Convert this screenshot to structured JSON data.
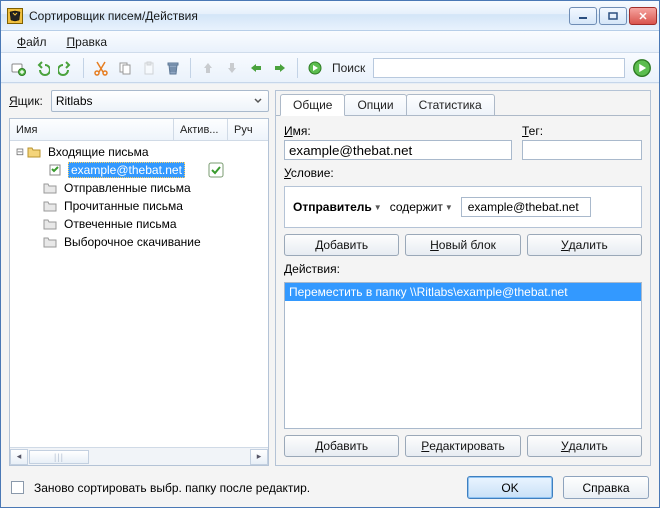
{
  "window": {
    "title": "Сортировщик писем/Действия"
  },
  "menu": {
    "file_u": "Ф",
    "file_rest": "айл",
    "edit_u": "П",
    "edit_rest": "равка"
  },
  "toolbar": {
    "search_label": "Поиск"
  },
  "left": {
    "box_u": "Я",
    "box_rest": "щик:",
    "combo_value": "Ritlabs",
    "col_name": "Имя",
    "col_active": "Актив...",
    "col_manual": "Руч",
    "nodes": {
      "inbox": "Входящие письма",
      "rule1": "example@thebat.net",
      "outbox": "Отправленные письма",
      "read": "Прочитанные письма",
      "replied": "Отвеченные письма",
      "selective": "Выборочное скачивание"
    },
    "thumb_marks": "|||"
  },
  "right": {
    "tab_general": "Общие",
    "tab_options": "Опции",
    "tab_stats": "Статистика",
    "name_u": "И",
    "name_rest": "мя:",
    "tag_u": "Т",
    "tag_rest": "ег:",
    "name_value": "example@thebat.net",
    "tag_value": "",
    "cond_u": "У",
    "cond_rest": "словие:",
    "cond_subject": "Отправитель",
    "cond_verb": "содержит",
    "cond_value": "example@thebat.net",
    "btn_add_u": "Д",
    "btn_add_rest": "обавить",
    "btn_newblock_u": "Н",
    "btn_newblock_rest": "овый блок",
    "btn_delete_u": "У",
    "btn_delete_rest": "далить",
    "actions_u": "Д",
    "actions_rest": "ействия:",
    "action_item": "Переместить в папку \\\\Ritlabs\\example@thebat.net",
    "btn_add2_u": "Д",
    "btn_add2_rest": "обавить",
    "btn_edit_u": "Р",
    "btn_edit_rest": "едактировать",
    "btn_del2_u": "У",
    "btn_del2_rest": "далить"
  },
  "bottom": {
    "resort_u": "З",
    "resort_rest": "аново сортировать выбр. папку после редактир.",
    "ok": "OK",
    "help": "Справка"
  }
}
